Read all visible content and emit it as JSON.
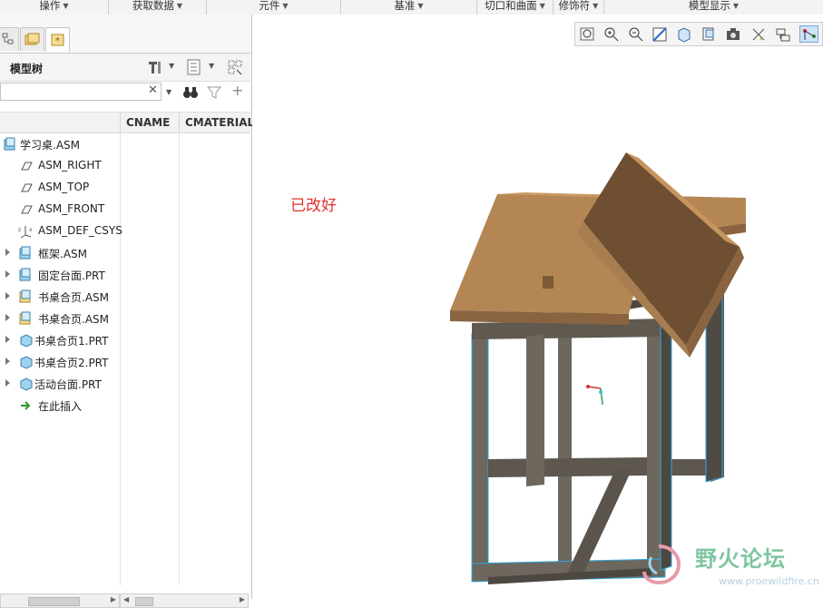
{
  "ribbon": {
    "groups": [
      {
        "label": "操作"
      },
      {
        "label": "获取数据"
      },
      {
        "label": "元件"
      },
      {
        "label": "基准"
      },
      {
        "label": "切口和曲面"
      },
      {
        "label": "修饰符"
      },
      {
        "label": "模型显示"
      }
    ]
  },
  "model_tree": {
    "title": "模型树",
    "columns": [
      "CNAME",
      "CMATERIAL"
    ],
    "items": [
      {
        "label": "学习桌.ASM",
        "icon": "assembly-icon",
        "expandable": false
      },
      {
        "label": "ASM_RIGHT",
        "icon": "datum-plane-icon",
        "expandable": false
      },
      {
        "label": "ASM_TOP",
        "icon": "datum-plane-icon",
        "expandable": false
      },
      {
        "label": "ASM_FRONT",
        "icon": "datum-plane-icon",
        "expandable": false
      },
      {
        "label": "ASM_DEF_CSYS",
        "icon": "csys-icon",
        "expandable": false
      },
      {
        "label": "框架.ASM",
        "icon": "assembly-icon",
        "expandable": true
      },
      {
        "label": "固定台面.PRT",
        "icon": "assembly-icon",
        "expandable": true
      },
      {
        "label": "书桌合页.ASM",
        "icon": "assembly-icon",
        "expandable": true
      },
      {
        "label": "书桌合页.ASM",
        "icon": "assembly-icon",
        "expandable": true
      },
      {
        "label": "书桌合页1.PRT",
        "icon": "part-icon",
        "expandable": true
      },
      {
        "label": "书桌合页2.PRT",
        "icon": "part-icon",
        "expandable": true
      },
      {
        "label": "活动台面.PRT",
        "icon": "part-icon",
        "expandable": true
      },
      {
        "label": "在此插入",
        "icon": "insert-here-icon",
        "expandable": false
      }
    ]
  },
  "viewport": {
    "note": "已改好",
    "watermark": "野火论坛",
    "watermark_url": "www.proewildfire.cn",
    "toolbar_icons": [
      "zoom-fit-icon",
      "zoom-in-icon",
      "zoom-out-icon",
      "repaint-icon",
      "display-style-icon",
      "saved-views-icon",
      "view-manager-icon",
      "datum-display-icon",
      "annotation-display-icon",
      "spin-center-icon"
    ]
  },
  "colors": {
    "tabletop": "#b38654",
    "tabletop_dark": "#7d5a36",
    "frame": "#6e675e",
    "frame_dark": "#4c4740",
    "highlight_edge": "#2aa8e0",
    "note": "#e0302a"
  }
}
